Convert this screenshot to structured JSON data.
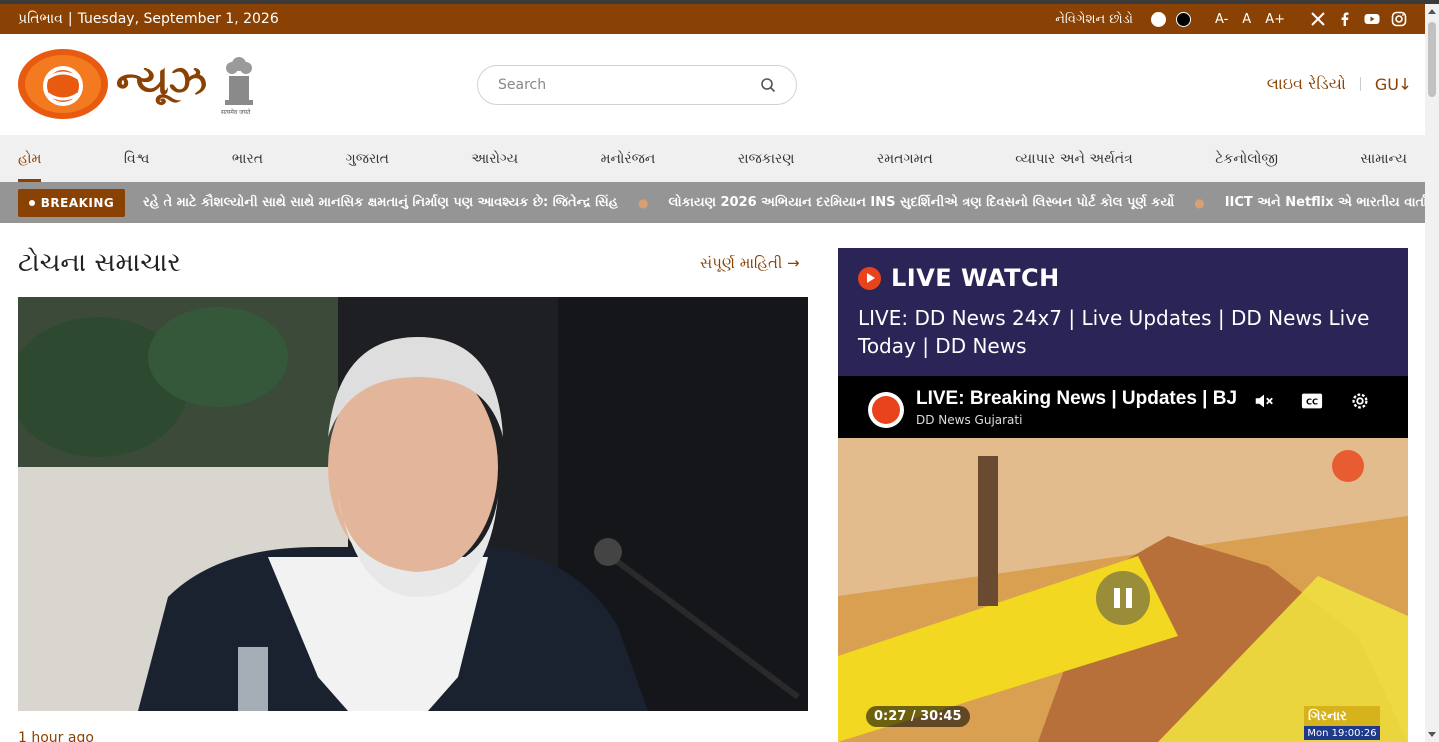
{
  "topbar": {
    "feedback": "પ્રતિભાવ",
    "separator": "|",
    "date": "Tuesday, September 1, 2026",
    "skip_nav": "નેવિગેશન છોડો",
    "font_decrease": "A-",
    "font_normal": "A",
    "font_increase": "A+"
  },
  "header": {
    "logo_text": "ન્યૂઝ",
    "emblem_caption": "सत्यमेव जयते",
    "search_placeholder": "Search",
    "live_radio": "લાઇવ રેડિયો",
    "language": "GU"
  },
  "nav": {
    "items": [
      "હોમ",
      "વિશ્વ",
      "ભારત",
      "ગુજરાત",
      "આરોગ્ય",
      "મનોરંજન",
      "રાજકારણ",
      "રમતગમત",
      "વ્યાપાર અને અર્થતંત્ર",
      "ટેકનોલોજી",
      "સામાન્ય"
    ]
  },
  "breaking": {
    "label": "BREAKING",
    "items": [
      "રહે તે માટે કૌશલ્યોની સાથે સાથે માનસિક ક્ષમતાનું નિર્માણ પણ આવશ્યક છે: જિતેન્દ્ર સિંહ",
      "લોકાયણ 2026 અભિયાન દરમિયાન INS સુદર્શિનીએ ત્રણ દિવસનો લિસ્બન પોર્ટ કોલ પૂર્ણ કર્યો",
      "IICT અને Netflix એ ભારતીય વાર્તાકારોની આગા"
    ]
  },
  "top_news": {
    "title": "ટોચના સમાચાર",
    "see_more": "સંપૂર્ણ માહિતી →",
    "time_ago": "1 hour ago"
  },
  "live_watch": {
    "title": "LIVE WATCH",
    "subtitle": "LIVE: DD News 24x7 | Live Updates | DD News Live Today | DD News",
    "video_title": "LIVE: Breaking News | Updates | BJ",
    "channel_name": "DD News Gujarati",
    "time": "0:27 / 30:45",
    "watermark_top": "ગિરનાર",
    "watermark_time": "Mon 19:00:26"
  },
  "colors": {
    "brand": "#8a4204",
    "live_bg": "#2a2457",
    "accent": "#e8431c"
  }
}
